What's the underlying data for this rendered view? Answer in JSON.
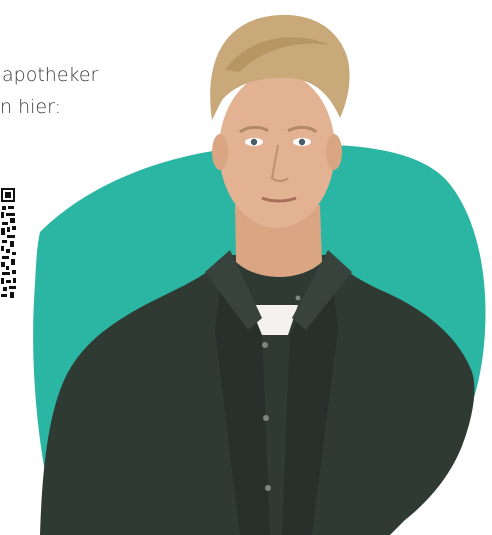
{
  "intro": {
    "line1": "apotheker",
    "line2": "n hier:"
  },
  "qr": {
    "icon": "qr-code-icon"
  },
  "colors": {
    "blob": "#2bb5a3",
    "shirt": "#2f3a33",
    "skin": "#e3b293",
    "hair": "#c9a87a",
    "text": "#3a3a3a"
  }
}
